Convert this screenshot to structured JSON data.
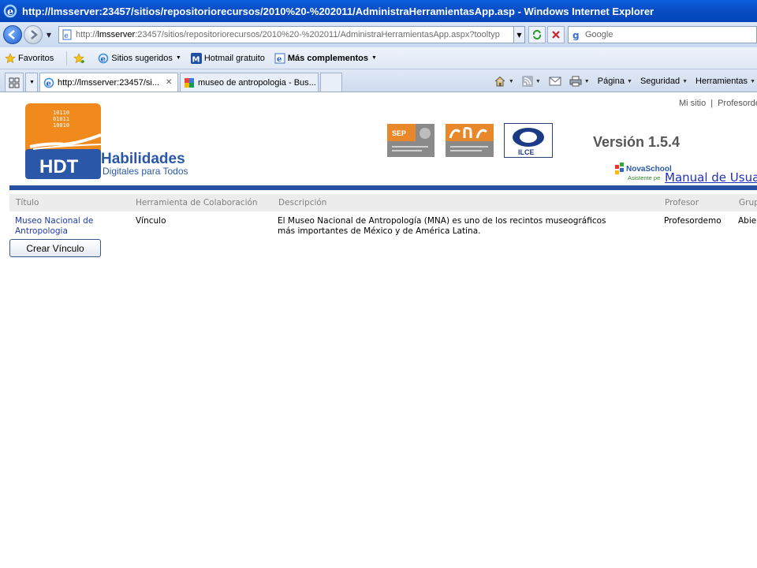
{
  "window": {
    "title": "http://lmsserver:23457/sitios/repositoriorecursos/2010%20-%202011/AdministraHerramientasApp.asp - Windows Internet Explorer"
  },
  "address_bar": {
    "prefix": "http://",
    "host": "lmsserver",
    "rest": ":23457/sitios/repositoriorecursos/2010%20-%202011/AdministraHerramientasApp.aspx?tooltyp",
    "search_placeholder": "Google"
  },
  "favorites_bar": {
    "favoritos": "Favoritos",
    "items": [
      "Sitios sugeridos",
      "Hotmail gratuito",
      "Más complementos"
    ]
  },
  "tabs": [
    {
      "label": "http://lmsserver:23457/si..."
    },
    {
      "label": "museo de antropologia - Bus..."
    }
  ],
  "command_bar": {
    "items": [
      "Página",
      "Seguridad",
      "Herramientas"
    ]
  },
  "page": {
    "top_links": {
      "mi_sitio": "Mi sitio",
      "separator": "|",
      "profesor": "Profesordemo"
    },
    "logo": {
      "hdt": "HDT",
      "line1": "Habilidades",
      "line2": "Digitales para Todos"
    },
    "sep_logo_text": "SEP",
    "ilce_logo_text": "ILCE",
    "version": "Versión 1.5.4",
    "novaschool": {
      "name": "NovaSchool",
      "tagline": "Asistente pe"
    },
    "manual_link": "Manual de Usuario",
    "grid": {
      "headers": [
        "Título",
        "Herramienta de Colaboración",
        "Descripción",
        "Profesor",
        "Grupo"
      ],
      "rows": [
        {
          "titulo_line1": "Museo Nacional de",
          "titulo_line2": "Antropologia",
          "herramienta": "Vínculo",
          "descripcion_line1": "El Museo Nacional de Antropología (MNA) es uno de los recintos museográficos",
          "descripcion_line2": "más importantes de México y de América Latina.",
          "profesor": "Profesordemo",
          "grupo": "Abierto"
        }
      ]
    },
    "crear_button": "Crear Vínculo"
  },
  "colors": {
    "titlebar": "#0a4fc8",
    "logo_orange": "#f08a1c",
    "logo_blue": "#2a57a8",
    "grid_rule": "#2750a0",
    "link": "#1f2fbf"
  }
}
